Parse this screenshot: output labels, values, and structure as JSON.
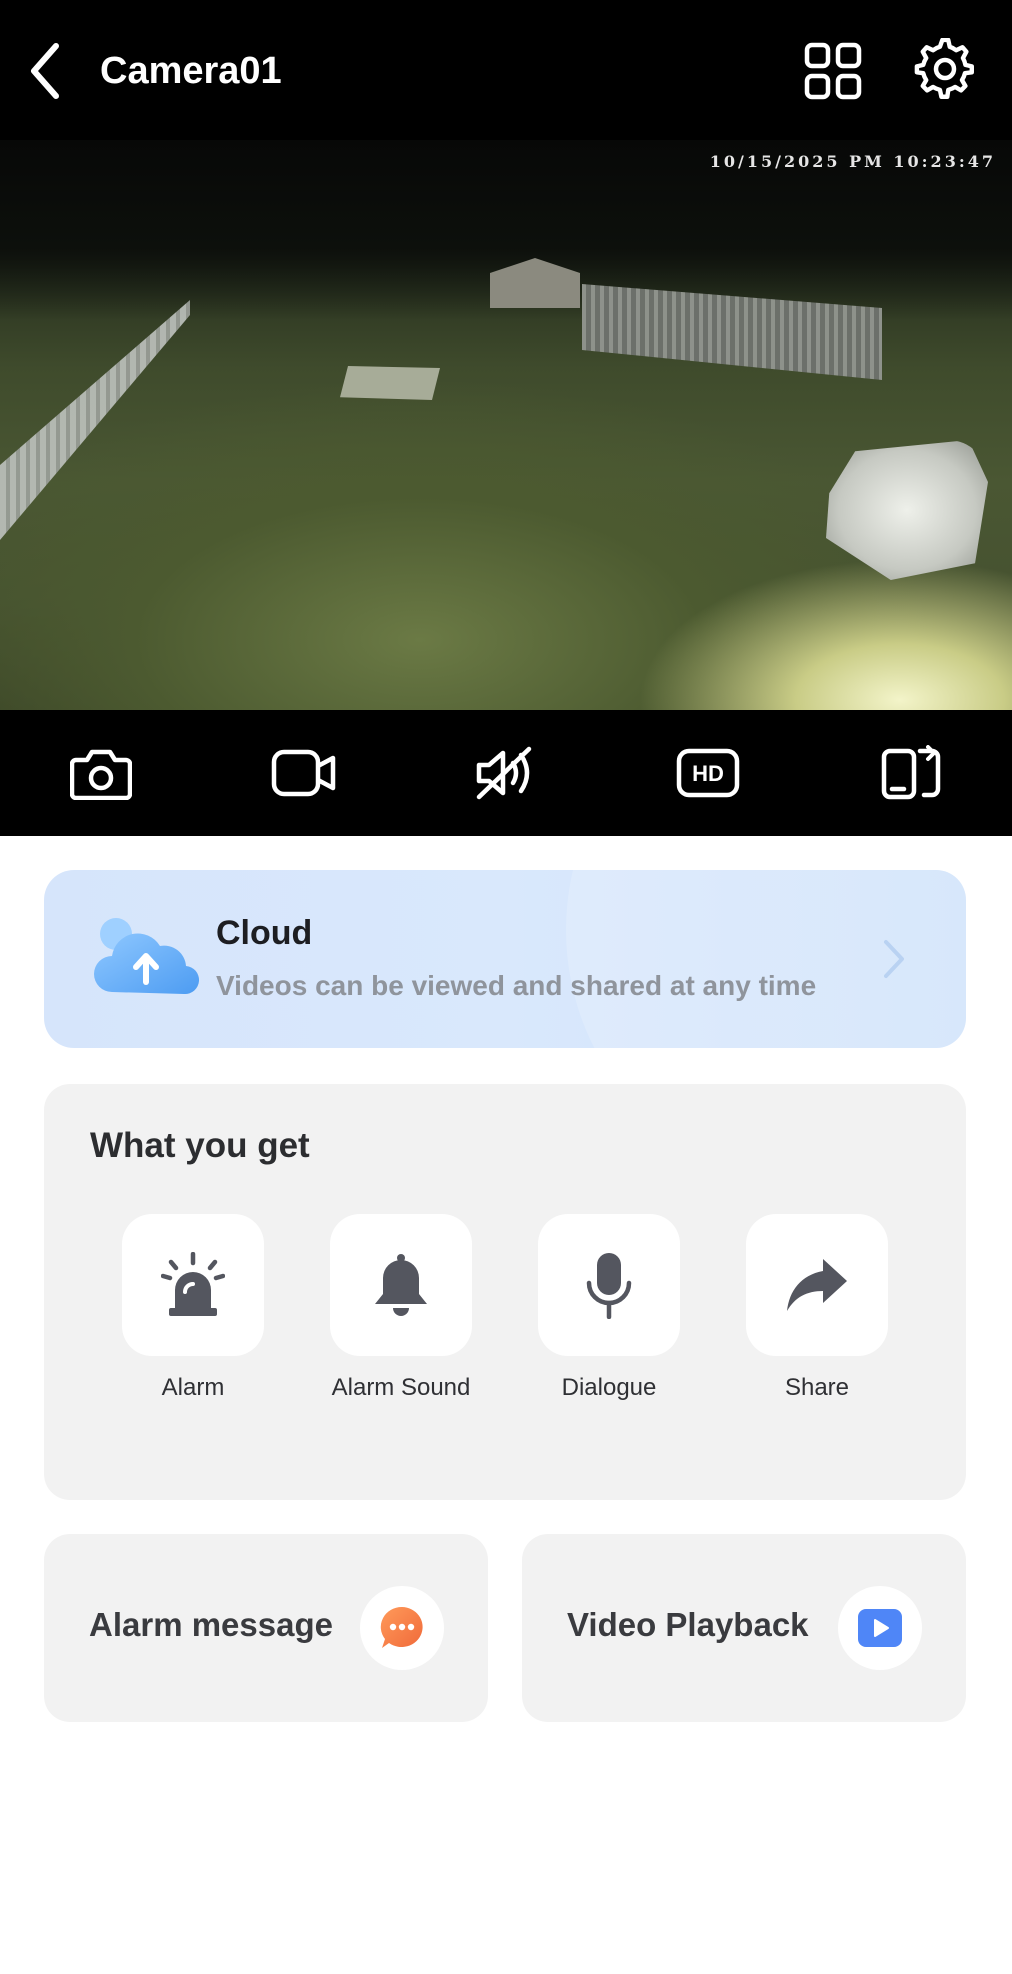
{
  "header": {
    "title": "Camera01",
    "back_icon": "chevron-left-icon",
    "grid_icon": "grid-icon",
    "settings_icon": "gear-icon"
  },
  "video": {
    "timestamp": "10/15/2025 PM 10:23:47"
  },
  "controls": [
    {
      "name": "snapshot",
      "icon": "camera-icon"
    },
    {
      "name": "record",
      "icon": "video-camera-icon"
    },
    {
      "name": "mute",
      "icon": "speaker-muted-icon"
    },
    {
      "name": "quality",
      "icon": "hd-icon",
      "label": "HD"
    },
    {
      "name": "fullscreen",
      "icon": "rotate-screen-icon"
    }
  ],
  "cloud": {
    "title": "Cloud",
    "subtitle": "Videos can be viewed and shared at any time",
    "icon": "cloud-upload-icon",
    "accent": "#6aa8f5"
  },
  "features": {
    "title": "What you get",
    "items": [
      {
        "label": "Alarm",
        "icon": "siren-icon"
      },
      {
        "label": "Alarm Sound",
        "icon": "bell-icon"
      },
      {
        "label": "Dialogue",
        "icon": "microphone-icon"
      },
      {
        "label": "Share",
        "icon": "share-arrow-icon"
      }
    ]
  },
  "bottom": {
    "alarm_message": {
      "label": "Alarm message",
      "icon": "chat-bubble-icon",
      "color": "#f47b45"
    },
    "video_playback": {
      "label": "Video Playback",
      "icon": "play-icon",
      "color": "#4f86f7"
    }
  }
}
